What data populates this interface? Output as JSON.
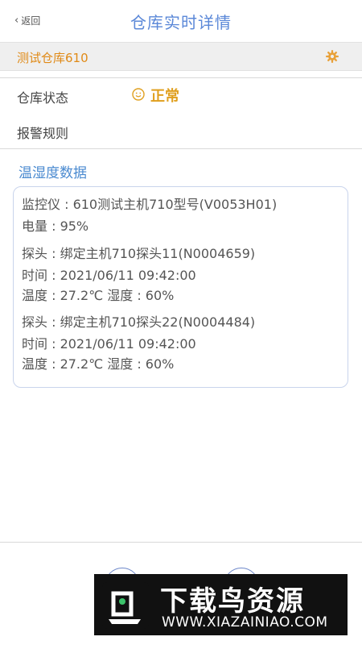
{
  "header": {
    "back_label": "返回",
    "title": "仓库实时详情"
  },
  "warehouse": {
    "name": "测试仓库610"
  },
  "status_row": {
    "label": "仓库状态",
    "value": "正常"
  },
  "alarm_row": {
    "label": "报警规则"
  },
  "section": {
    "title": "温湿度数据"
  },
  "card": {
    "monitor": "监控仪 : 610测试主机710型号(V0053H01)",
    "battery": "电量 : 95%",
    "probes": [
      {
        "name": "探头 : 绑定主机710探头11(N0004659)",
        "time": "时间 : 2021/06/11 09:42:00",
        "temp_humidity": "温度 : 27.2℃  湿度 : 60%"
      },
      {
        "name": "探头 : 绑定主机710探头22(N0004484)",
        "time": "时间 : 2021/06/11 09:42:00",
        "temp_humidity": "温度 : 27.2℃  湿度 : 60%"
      }
    ]
  },
  "watermark": {
    "title": "下载鸟资源",
    "url": "WWW.XIAZAINIAO.COM"
  },
  "colors": {
    "accent_blue": "#5b88d8",
    "orange": "#e08a17",
    "status_yellow": "#e0a020"
  },
  "icons": {
    "back": "chevron-left-icon",
    "settings": "gear-icon",
    "status": "smile-icon"
  }
}
